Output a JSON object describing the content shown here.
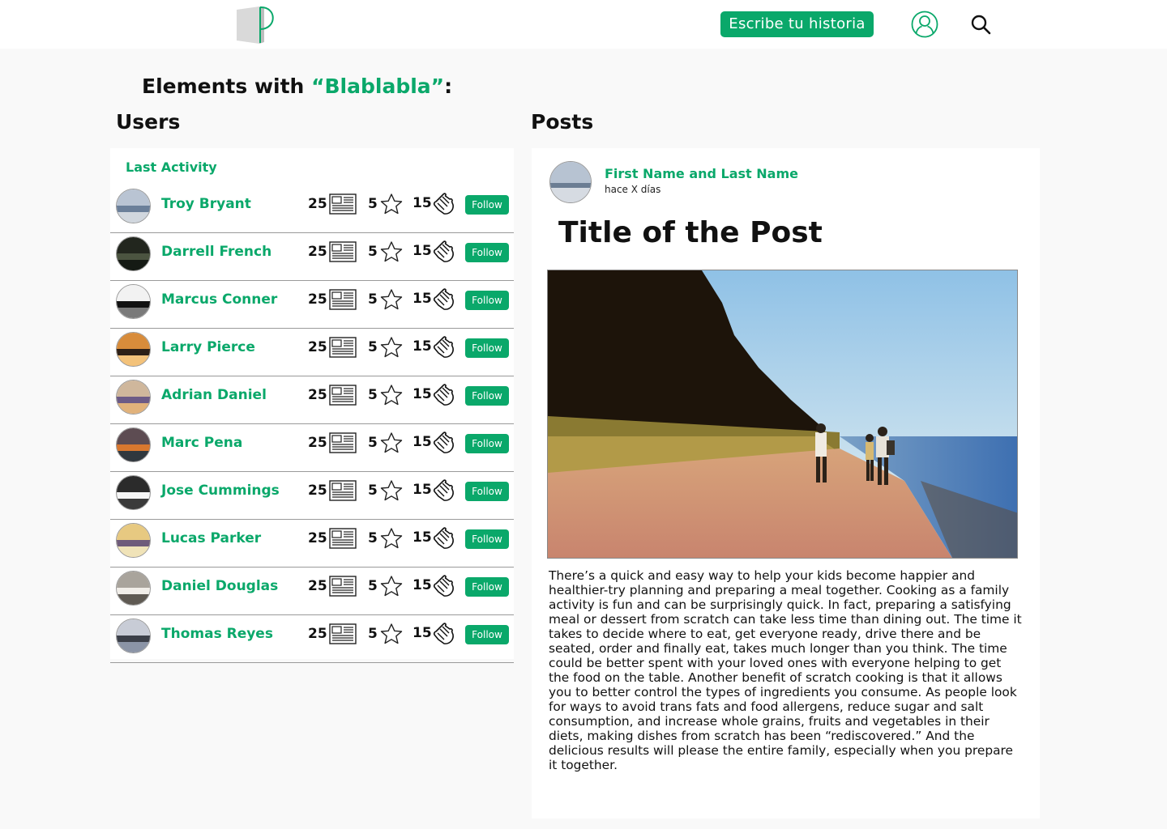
{
  "header": {
    "logo_icon": "p-logo-icon",
    "write_button_label": "Escribe tu historia",
    "user_icon": "user-profile-icon",
    "search_icon": "search-icon",
    "accent_color": "#0aa86a"
  },
  "search": {
    "heading_prefix": "Elements with ",
    "term": "“Blablabla”",
    "heading_suffix": ":"
  },
  "users": {
    "title": "Users",
    "sort_label": "Last Activity",
    "follow_label": "Follow",
    "items": [
      {
        "name": "Troy Bryant",
        "posts": "25",
        "stars": "5",
        "claps": "15"
      },
      {
        "name": "Darrell French",
        "posts": "25",
        "stars": "5",
        "claps": "15"
      },
      {
        "name": "Marcus Conner",
        "posts": "25",
        "stars": "5",
        "claps": "15"
      },
      {
        "name": "Larry Pierce",
        "posts": "25",
        "stars": "5",
        "claps": "15"
      },
      {
        "name": "Adrian Daniel",
        "posts": "25",
        "stars": "5",
        "claps": "15"
      },
      {
        "name": "Marc Pena",
        "posts": "25",
        "stars": "5",
        "claps": "15"
      },
      {
        "name": "Jose Cummings",
        "posts": "25",
        "stars": "5",
        "claps": "15"
      },
      {
        "name": "Lucas Parker",
        "posts": "25",
        "stars": "5",
        "claps": "15"
      },
      {
        "name": "Daniel Douglas",
        "posts": "25",
        "stars": "5",
        "claps": "15"
      },
      {
        "name": "Thomas Reyes",
        "posts": "25",
        "stars": "5",
        "claps": "15"
      }
    ]
  },
  "posts": {
    "title": "Posts",
    "post": {
      "author": "First Name and Last Name",
      "time": "hace X días",
      "title": "Title of the Post",
      "body": "There’s a quick and easy way to help your kids become happier and healthier-try planning and preparing a meal together. Cooking as a family activity is fun and can be surprisingly quick. In fact, preparing a satisfying meal or dessert from scratch can take less time than dining out. The time it takes to decide where to eat, get everyone ready, drive there and be seated, order and finally eat, takes much longer than you think. The time could be better spent with your loved ones with everyone helping to get the food on the table. Another benefit of scratch cooking is that it allows you to better control the types of ingredients you consume. As people look for ways to avoid trans fats and food allergens, reduce sugar and salt consumption, and increase whole grains, fruits and vegetables in their diets, making dishes from scratch has been “rediscovered.” And the delicious results will please the entire family, especially when you prepare it together."
    }
  }
}
